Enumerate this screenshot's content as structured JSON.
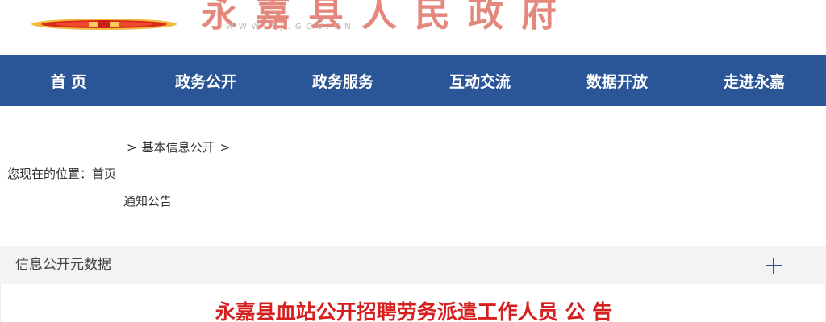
{
  "header": {
    "site_title": "永嘉县人民政府",
    "site_url": "WWW.YJ.GOV.CN"
  },
  "nav": {
    "items": [
      {
        "label": "首 页"
      },
      {
        "label": "政务公开"
      },
      {
        "label": "政务服务"
      },
      {
        "label": "互动交流"
      },
      {
        "label": "数据开放"
      },
      {
        "label": "走进永嘉"
      }
    ]
  },
  "breadcrumb": {
    "prefix": "您现在的位置：",
    "home": "首页",
    "separator": ">",
    "section": "基本信息公开",
    "category": "通知公告"
  },
  "meta": {
    "label": "信息公开元数据"
  },
  "article": {
    "title": "永嘉县血站公开招聘劳务派遣工作人员 公 告"
  },
  "colors": {
    "nav_bg": "#2a5597",
    "title_red": "#d6201f",
    "plus_blue": "#2a5597"
  },
  "icons": {
    "emblem": "national-emblem-icon",
    "expand": "plus-icon"
  }
}
